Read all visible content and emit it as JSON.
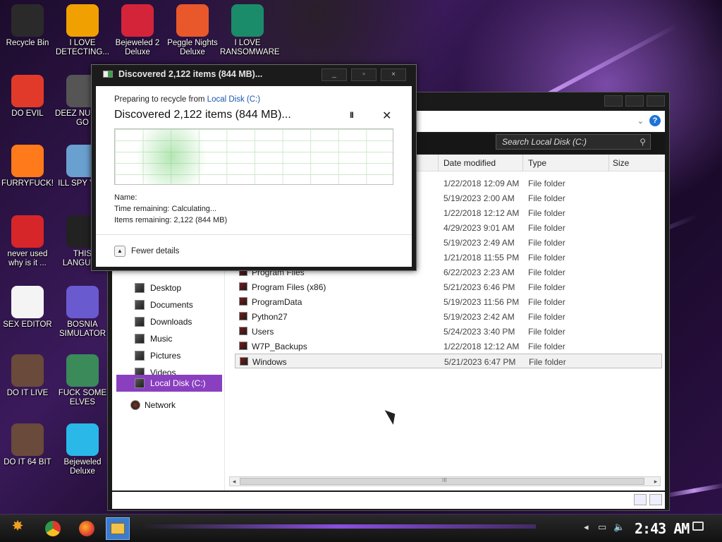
{
  "desktop": {
    "icons": [
      {
        "label": "Recycle Bin",
        "icon": "recycle-bin-icon",
        "color": "#2a2a2a"
      },
      {
        "label": "I LOVE DETECTING...",
        "icon": "detect-it-easy-icon",
        "color": "#f0a000"
      },
      {
        "label": "Bejeweled 2 Deluxe",
        "icon": "bejeweled-2-icon",
        "color": "#d4243a"
      },
      {
        "label": "Peggle Nights Deluxe",
        "icon": "peggle-icon",
        "color": "#e8582a"
      },
      {
        "label": "I LOVE RANSOMWARE",
        "icon": "publisher-icon",
        "color": "#1a8c6a"
      },
      {
        "label": "DO EVIL",
        "icon": "chrome-icon",
        "color": "#e23a2a"
      },
      {
        "label": "DEEZ NU HAH GO",
        "icon": "window-stack-icon",
        "color": "#555555"
      },
      {
        "label": "FURRYFUCK!",
        "icon": "firefox-icon",
        "color": "#ff7a1a"
      },
      {
        "label": "ILL SPY YOU",
        "icon": "spy-tool-icon",
        "color": "#6aa0d0"
      },
      {
        "label": "never used why is it ...",
        "icon": "dev-cpp-icon",
        "color": "#d6262a"
      },
      {
        "label": "THIS LANGUAG",
        "icon": "golang-icon",
        "color": "#222222"
      },
      {
        "label": "SEX EDITOR",
        "icon": "hxd-icon",
        "color": "#f4f4f4"
      },
      {
        "label": "BOSNIA SIMULATOR",
        "icon": "spiky-ball-icon",
        "color": "#6a5ad0"
      },
      {
        "label": "DO IT LIVE",
        "icon": "portrait-icon",
        "color": "#6a4a3a"
      },
      {
        "label": "FUCK SOME ELVES",
        "icon": "elf-icon",
        "color": "#3a8a5a"
      },
      {
        "label": "DO IT 64 BIT",
        "icon": "portrait-64-icon",
        "color": "#6a4a3a"
      },
      {
        "label": "Bejeweled Deluxe",
        "icon": "diamond-icon",
        "color": "#2ab8e8"
      }
    ]
  },
  "dialog": {
    "title": "Discovered 2,122 items (844 MB)...",
    "prep_prefix": "Preparing to recycle from ",
    "prep_link": "Local Disk (C:)",
    "headline": "Discovered 2,122 items (844 MB)...",
    "pause_glyph": "II",
    "close_glyph": "✕",
    "name_label": "Name:",
    "time_remaining": "Time remaining: Calculating...",
    "items_remaining": "Items remaining: 2,122 (844 MB)",
    "fewer_details": "Fewer details",
    "controls": {
      "minimize": "_",
      "maximize": "▫",
      "close": "×"
    }
  },
  "explorer": {
    "search_placeholder": "Search Local Disk (C:)",
    "columns": {
      "date": "Date modified",
      "type": "Type",
      "size": "Size"
    },
    "nav": [
      {
        "label": "Desktop"
      },
      {
        "label": "Documents"
      },
      {
        "label": "Downloads"
      },
      {
        "label": "Music"
      },
      {
        "label": "Pictures"
      },
      {
        "label": "Videos"
      },
      {
        "label": "Local Disk (C:)"
      },
      {
        "label": "Network"
      }
    ],
    "rows": [
      {
        "name": "",
        "date": "1/22/2018 12:09 AM",
        "type": "File folder"
      },
      {
        "name": "",
        "date": "5/19/2023 2:00 AM",
        "type": "File folder"
      },
      {
        "name": "",
        "date": "1/22/2018 12:12 AM",
        "type": "File folder"
      },
      {
        "name": "",
        "date": "4/29/2023 9:01 AM",
        "type": "File folder"
      },
      {
        "name": "",
        "date": "5/19/2023 2:49 AM",
        "type": "File folder"
      },
      {
        "name": "",
        "date": "1/21/2018 11:55 PM",
        "type": "File folder"
      },
      {
        "name": "Program Files",
        "date": "6/22/2023 2:23 AM",
        "type": "File folder"
      },
      {
        "name": "Program Files (x86)",
        "date": "5/21/2023 6:46 PM",
        "type": "File folder"
      },
      {
        "name": "ProgramData",
        "date": "5/19/2023 11:56 PM",
        "type": "File folder"
      },
      {
        "name": "Python27",
        "date": "5/19/2023 2:42 AM",
        "type": "File folder"
      },
      {
        "name": "Users",
        "date": "5/24/2023 3:40 PM",
        "type": "File folder"
      },
      {
        "name": "W7P_Backups",
        "date": "1/22/2018 12:12 AM",
        "type": "File folder"
      },
      {
        "name": "Windows",
        "date": "5/21/2023 6:47 PM",
        "type": "File folder"
      }
    ],
    "scroll_grip": "III"
  },
  "taskbar": {
    "clock": "2:43 AM",
    "tray_glyphs": {
      "chevron": "◂",
      "network": "▭",
      "volume": "🔈"
    }
  },
  "colors": {
    "accent": "#8a3fc0",
    "link": "#1c55b0"
  }
}
